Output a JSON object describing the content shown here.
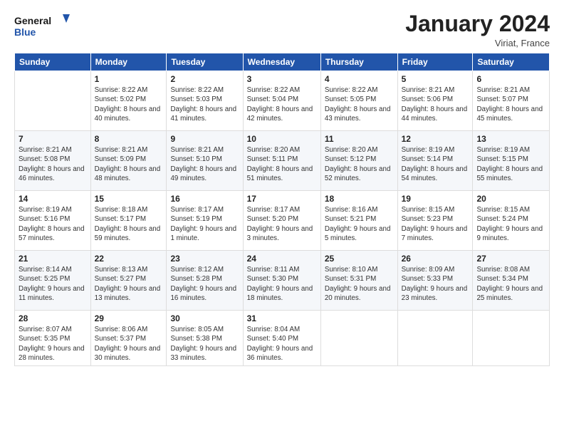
{
  "header": {
    "logo_line1": "General",
    "logo_line2": "Blue",
    "month_title": "January 2024",
    "location": "Viriat, France"
  },
  "weekdays": [
    "Sunday",
    "Monday",
    "Tuesday",
    "Wednesday",
    "Thursday",
    "Friday",
    "Saturday"
  ],
  "weeks": [
    [
      {
        "day": "",
        "sunrise": "",
        "sunset": "",
        "daylight": ""
      },
      {
        "day": "1",
        "sunrise": "Sunrise: 8:22 AM",
        "sunset": "Sunset: 5:02 PM",
        "daylight": "Daylight: 8 hours and 40 minutes."
      },
      {
        "day": "2",
        "sunrise": "Sunrise: 8:22 AM",
        "sunset": "Sunset: 5:03 PM",
        "daylight": "Daylight: 8 hours and 41 minutes."
      },
      {
        "day": "3",
        "sunrise": "Sunrise: 8:22 AM",
        "sunset": "Sunset: 5:04 PM",
        "daylight": "Daylight: 8 hours and 42 minutes."
      },
      {
        "day": "4",
        "sunrise": "Sunrise: 8:22 AM",
        "sunset": "Sunset: 5:05 PM",
        "daylight": "Daylight: 8 hours and 43 minutes."
      },
      {
        "day": "5",
        "sunrise": "Sunrise: 8:21 AM",
        "sunset": "Sunset: 5:06 PM",
        "daylight": "Daylight: 8 hours and 44 minutes."
      },
      {
        "day": "6",
        "sunrise": "Sunrise: 8:21 AM",
        "sunset": "Sunset: 5:07 PM",
        "daylight": "Daylight: 8 hours and 45 minutes."
      }
    ],
    [
      {
        "day": "7",
        "sunrise": "Sunrise: 8:21 AM",
        "sunset": "Sunset: 5:08 PM",
        "daylight": "Daylight: 8 hours and 46 minutes."
      },
      {
        "day": "8",
        "sunrise": "Sunrise: 8:21 AM",
        "sunset": "Sunset: 5:09 PM",
        "daylight": "Daylight: 8 hours and 48 minutes."
      },
      {
        "day": "9",
        "sunrise": "Sunrise: 8:21 AM",
        "sunset": "Sunset: 5:10 PM",
        "daylight": "Daylight: 8 hours and 49 minutes."
      },
      {
        "day": "10",
        "sunrise": "Sunrise: 8:20 AM",
        "sunset": "Sunset: 5:11 PM",
        "daylight": "Daylight: 8 hours and 51 minutes."
      },
      {
        "day": "11",
        "sunrise": "Sunrise: 8:20 AM",
        "sunset": "Sunset: 5:12 PM",
        "daylight": "Daylight: 8 hours and 52 minutes."
      },
      {
        "day": "12",
        "sunrise": "Sunrise: 8:19 AM",
        "sunset": "Sunset: 5:14 PM",
        "daylight": "Daylight: 8 hours and 54 minutes."
      },
      {
        "day": "13",
        "sunrise": "Sunrise: 8:19 AM",
        "sunset": "Sunset: 5:15 PM",
        "daylight": "Daylight: 8 hours and 55 minutes."
      }
    ],
    [
      {
        "day": "14",
        "sunrise": "Sunrise: 8:19 AM",
        "sunset": "Sunset: 5:16 PM",
        "daylight": "Daylight: 8 hours and 57 minutes."
      },
      {
        "day": "15",
        "sunrise": "Sunrise: 8:18 AM",
        "sunset": "Sunset: 5:17 PM",
        "daylight": "Daylight: 8 hours and 59 minutes."
      },
      {
        "day": "16",
        "sunrise": "Sunrise: 8:17 AM",
        "sunset": "Sunset: 5:19 PM",
        "daylight": "Daylight: 9 hours and 1 minute."
      },
      {
        "day": "17",
        "sunrise": "Sunrise: 8:17 AM",
        "sunset": "Sunset: 5:20 PM",
        "daylight": "Daylight: 9 hours and 3 minutes."
      },
      {
        "day": "18",
        "sunrise": "Sunrise: 8:16 AM",
        "sunset": "Sunset: 5:21 PM",
        "daylight": "Daylight: 9 hours and 5 minutes."
      },
      {
        "day": "19",
        "sunrise": "Sunrise: 8:15 AM",
        "sunset": "Sunset: 5:23 PM",
        "daylight": "Daylight: 9 hours and 7 minutes."
      },
      {
        "day": "20",
        "sunrise": "Sunrise: 8:15 AM",
        "sunset": "Sunset: 5:24 PM",
        "daylight": "Daylight: 9 hours and 9 minutes."
      }
    ],
    [
      {
        "day": "21",
        "sunrise": "Sunrise: 8:14 AM",
        "sunset": "Sunset: 5:25 PM",
        "daylight": "Daylight: 9 hours and 11 minutes."
      },
      {
        "day": "22",
        "sunrise": "Sunrise: 8:13 AM",
        "sunset": "Sunset: 5:27 PM",
        "daylight": "Daylight: 9 hours and 13 minutes."
      },
      {
        "day": "23",
        "sunrise": "Sunrise: 8:12 AM",
        "sunset": "Sunset: 5:28 PM",
        "daylight": "Daylight: 9 hours and 16 minutes."
      },
      {
        "day": "24",
        "sunrise": "Sunrise: 8:11 AM",
        "sunset": "Sunset: 5:30 PM",
        "daylight": "Daylight: 9 hours and 18 minutes."
      },
      {
        "day": "25",
        "sunrise": "Sunrise: 8:10 AM",
        "sunset": "Sunset: 5:31 PM",
        "daylight": "Daylight: 9 hours and 20 minutes."
      },
      {
        "day": "26",
        "sunrise": "Sunrise: 8:09 AM",
        "sunset": "Sunset: 5:33 PM",
        "daylight": "Daylight: 9 hours and 23 minutes."
      },
      {
        "day": "27",
        "sunrise": "Sunrise: 8:08 AM",
        "sunset": "Sunset: 5:34 PM",
        "daylight": "Daylight: 9 hours and 25 minutes."
      }
    ],
    [
      {
        "day": "28",
        "sunrise": "Sunrise: 8:07 AM",
        "sunset": "Sunset: 5:35 PM",
        "daylight": "Daylight: 9 hours and 28 minutes."
      },
      {
        "day": "29",
        "sunrise": "Sunrise: 8:06 AM",
        "sunset": "Sunset: 5:37 PM",
        "daylight": "Daylight: 9 hours and 30 minutes."
      },
      {
        "day": "30",
        "sunrise": "Sunrise: 8:05 AM",
        "sunset": "Sunset: 5:38 PM",
        "daylight": "Daylight: 9 hours and 33 minutes."
      },
      {
        "day": "31",
        "sunrise": "Sunrise: 8:04 AM",
        "sunset": "Sunset: 5:40 PM",
        "daylight": "Daylight: 9 hours and 36 minutes."
      },
      {
        "day": "",
        "sunrise": "",
        "sunset": "",
        "daylight": ""
      },
      {
        "day": "",
        "sunrise": "",
        "sunset": "",
        "daylight": ""
      },
      {
        "day": "",
        "sunrise": "",
        "sunset": "",
        "daylight": ""
      }
    ]
  ]
}
